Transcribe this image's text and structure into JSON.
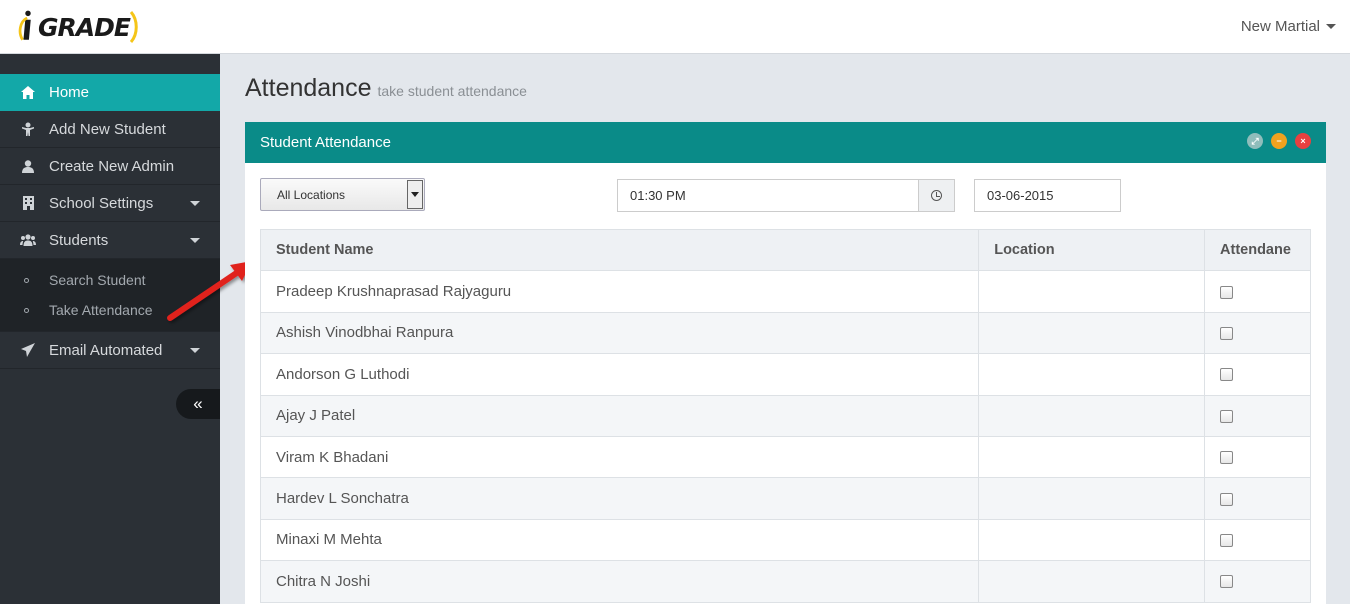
{
  "brand": {
    "logo_text": "GRADE"
  },
  "header": {
    "user_name": "New Martial"
  },
  "sidebar": {
    "items": [
      {
        "label": "Home",
        "icon": "home-icon"
      },
      {
        "label": "Add New Student",
        "icon": "student-icon"
      },
      {
        "label": "Create New Admin",
        "icon": "user-icon"
      },
      {
        "label": "School Settings",
        "icon": "building-icon"
      },
      {
        "label": "Students",
        "icon": "users-icon"
      },
      {
        "label": "Email Automated",
        "icon": "paper-plane-icon"
      }
    ],
    "submenu": [
      {
        "label": "Search Student"
      },
      {
        "label": "Take Attendance"
      }
    ],
    "collapse_glyph": "«"
  },
  "page": {
    "title": "Attendance",
    "subtitle": "take student attendance"
  },
  "panel": {
    "title": "Student Attendance",
    "location_select": "All Locations",
    "time_value": "01:30 PM",
    "date_value": "03-06-2015",
    "columns": [
      "Student Name",
      "Location",
      "Attendane"
    ],
    "rows": [
      {
        "name": "Pradeep Krushnaprasad Rajyaguru",
        "location": ""
      },
      {
        "name": "Ashish Vinodbhai Ranpura",
        "location": ""
      },
      {
        "name": "Andorson G Luthodi",
        "location": ""
      },
      {
        "name": "Ajay J Patel",
        "location": ""
      },
      {
        "name": "Viram K Bhadani",
        "location": ""
      },
      {
        "name": "Hardev L Sonchatra",
        "location": ""
      },
      {
        "name": "Minaxi M Mehta",
        "location": ""
      },
      {
        "name": "Chitra N Joshi",
        "location": ""
      }
    ]
  },
  "colors": {
    "accent": "#13a8a8",
    "panel_header": "#0a8b88",
    "sidebar_bg": "#2b3036",
    "logo_yellow": "#f5c518",
    "arrow_red": "#e0201f"
  }
}
